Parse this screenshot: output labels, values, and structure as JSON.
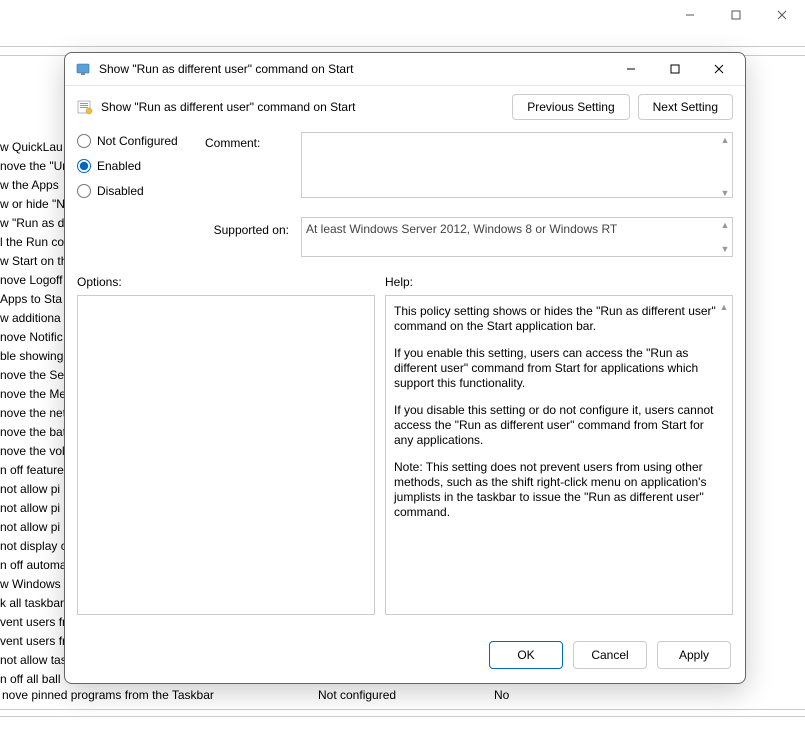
{
  "dialog": {
    "title": "Show \"Run as different user\" command on Start",
    "header_label": "Show \"Run as different user\" command on Start",
    "prev_btn": "Previous Setting",
    "next_btn": "Next Setting",
    "radios": {
      "not_configured": "Not Configured",
      "enabled": "Enabled",
      "disabled": "Disabled",
      "selected": "enabled"
    },
    "comment_label": "Comment:",
    "comment_value": "",
    "supported_label": "Supported on:",
    "supported_value": "At least Windows Server 2012, Windows 8 or Windows RT",
    "options_label": "Options:",
    "help_label": "Help:",
    "help": {
      "p1": "This policy setting shows or hides the \"Run as different user\" command on the Start application bar.",
      "p2": "If you enable this setting, users can access the \"Run as different user\" command from Start for applications which support this functionality.",
      "p3": "If you disable this setting or do not configure it, users cannot access the \"Run as different user\" command from Start for any applications.",
      "p4": "Note: This setting does not prevent users from using other methods, such as the shift right-click menu on application's jumplists in the taskbar to issue the \"Run as different user\" command."
    },
    "ok": "OK",
    "cancel": "Cancel",
    "apply": "Apply"
  },
  "background": {
    "list": [
      "w QuickLau",
      "nove the \"Ur",
      "w the Apps",
      "w or hide \"N",
      "w \"Run as d",
      "l the Run co",
      "w Start on th",
      "nove Logoff",
      "Apps to Sta",
      "w additiona",
      "nove Notific",
      "ble showing",
      "nove the Sec",
      "nove the Me",
      "nove the net",
      "nove the bat",
      "nove the vol",
      "n off feature",
      "not allow pi",
      "not allow pi",
      "not allow pi",
      "not display c",
      "n off automa",
      "w Windows",
      "k all taskbar",
      "vent users fr",
      "vent users fr",
      "not allow tas",
      "n off all ball"
    ],
    "bottom_row": {
      "title": "nove pinned programs from the Taskbar",
      "state": "Not configured",
      "comment": "No"
    }
  }
}
